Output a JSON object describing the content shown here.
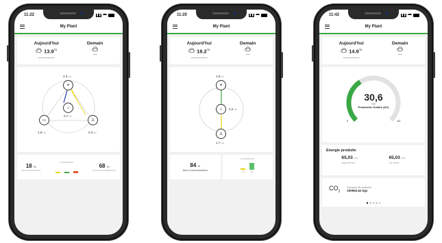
{
  "phones": [
    {
      "time": "11:22",
      "title": "My Plant",
      "today_label": "Aujourd'hui",
      "tomorrow_label": "Demain",
      "today_temp": "13.9",
      "temp_unit": "°C",
      "stats": {
        "left_pct": "18",
        "left_label": "AUTO SUFFISANCE",
        "right_pct": "68",
        "right_label": "AUTO CONSOMMATION",
        "middle_label": "AUJOURD'HUI",
        "unit": "%"
      },
      "flow": {
        "solar": "2,3",
        "home": "0,7",
        "battery": "1,9",
        "grid": "0,3",
        "unit": "kW"
      }
    },
    {
      "time": "11:20",
      "title": "My Plant",
      "today_label": "Aujourd'hui",
      "tomorrow_label": "Demain",
      "today_temp": "18.2",
      "temp_unit": "°C",
      "stats": {
        "left_pct": "84",
        "left_label": "Auto-Consommation",
        "middle_label": "AUJOURD'HUI",
        "unit": "%",
        "bar_a": "0,6",
        "bar_b": "19"
      },
      "flow": {
        "solar": "1,9",
        "home": "0,2",
        "grid": "1,7",
        "unit": "kW"
      }
    },
    {
      "time": "11:42",
      "title": "My Plant",
      "today_label": "Aujourd'hui",
      "tomorrow_label": "Demain",
      "today_temp": "14.9",
      "temp_unit": "°C",
      "gauge": {
        "value": "30,6",
        "unit": "KW",
        "label": "Production Solaire (AC)",
        "min": "0",
        "max": "81",
        "fraction": 0.38
      },
      "energy": {
        "title": "Energie produite",
        "today_value": "65,03",
        "today_unit": "kWh",
        "today_label": "Aujourd'hui",
        "month_value": "65,03",
        "month_unit": "kWh",
        "month_label": "Ce mois"
      },
      "co2": {
        "symbol": "CO",
        "sub": "2",
        "label": "Dioxyde de carbone",
        "value": "200962,52 kgs"
      }
    }
  ],
  "colors": {
    "accent": "#3aa845",
    "solar_arrow": "#e8d200",
    "home_arrow": "#1f3aa8",
    "gauge_track": "#e2e2e2"
  },
  "icons": [
    "sun-icon",
    "home-icon",
    "battery-icon",
    "grid-tower-icon",
    "cloud-icon",
    "menu-icon"
  ]
}
